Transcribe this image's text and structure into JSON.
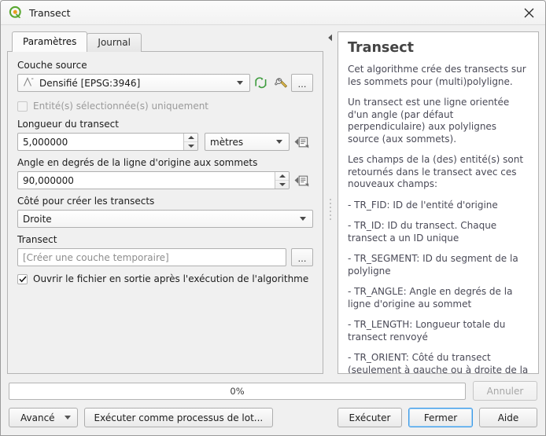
{
  "window": {
    "title": "Transect",
    "app_icon": "qgis-logo-icon",
    "close_label": "×"
  },
  "tabs": [
    {
      "label": "Paramètres",
      "active": true
    },
    {
      "label": "Journal",
      "active": false
    }
  ],
  "parameters": {
    "source_layer": {
      "label": "Couche source",
      "value": "Densifié [EPSG:3946]",
      "icon": "line-layer-icon",
      "iterate_icon": "iterate-over-features-icon",
      "advanced_icon": "wrench-icon",
      "browse_label": "…"
    },
    "selected_only": {
      "label": "Entité(s) sélectionnée(s) uniquement",
      "checked": false,
      "enabled": false
    },
    "transect_length": {
      "label": "Longueur du transect",
      "value": "5,000000",
      "unit": "mètres",
      "data_define_icon": "data-defined-override-icon"
    },
    "angle": {
      "label": "Angle en degrés de la ligne d'origine aux sommets",
      "value": "90,000000",
      "data_define_icon": "data-defined-override-icon"
    },
    "side": {
      "label": "Côté pour créer les transects",
      "value": "Droite"
    },
    "output": {
      "label": "Transect",
      "placeholder": "[Créer une couche temporaire]",
      "value": "",
      "browse_label": "…"
    },
    "open_output": {
      "label": "Ouvrir le fichier en sortie après l'exécution de l'algorithme",
      "checked": true
    }
  },
  "help": {
    "title": "Transect",
    "paragraphs": [
      "Cet algorithme crée des transects sur les sommets pour (multi)polyligne.",
      "Un transect est une ligne orientée d'un angle (par défaut perpendiculaire) aux polylignes source (aux sommets).",
      "Les champs de la (des) entité(s) sont retournés dans le transect avec ces nouveaux champs:",
      "- TR_FID: ID de l'entité d'origine",
      "- TR_ID: ID du transect. Chaque transect a un ID unique",
      "- TR_SEGMENT: ID du segment de la polyligne",
      "- TR_ANGLE: Angle en degrés de la ligne d'origine au sommet",
      "- TR_LENGTH: Longueur totale du transect renvoyé",
      "- TR_ORIENT: Côté du transect (seulement à gauche ou à droite de la ligne, ou des deux côtés)"
    ]
  },
  "footer": {
    "progress_text": "0%",
    "progress_value": 0,
    "cancel_label": "Annuler",
    "advanced_label": "Avancé",
    "batch_label": "Exécuter comme processus de lot...",
    "run_label": "Exécuter",
    "close_label": "Fermer",
    "help_label": "Aide"
  },
  "colors": {
    "accent_green": "#5aa832",
    "focus_blue": "#3c9ae8",
    "help_text": "#4a4a57"
  }
}
